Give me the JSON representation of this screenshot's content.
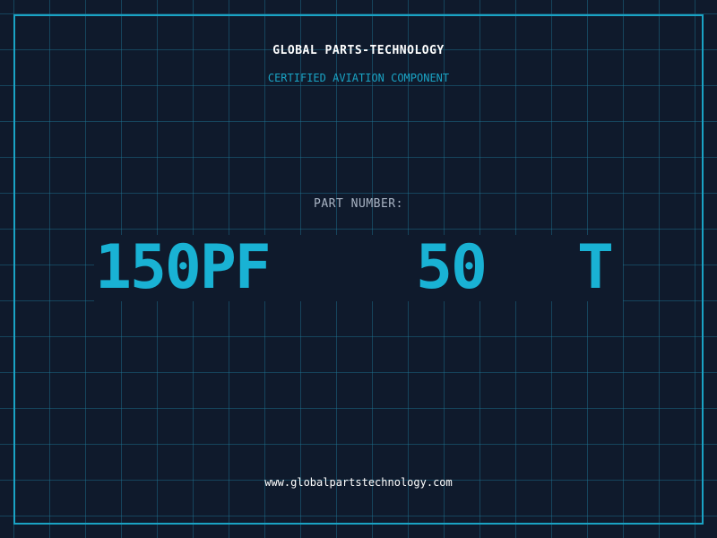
{
  "header": {
    "title": "GLOBAL PARTS-TECHNOLOGY",
    "subtitle": "CERTIFIED AVIATION COMPONENT"
  },
  "part": {
    "label": "PART NUMBER:",
    "segments": [
      "150PF",
      "50",
      "T"
    ]
  },
  "footer": {
    "url": "www.globalpartstechnology.com"
  },
  "colors": {
    "background": "#0f1a2c",
    "grid": "#1e7896",
    "accent": "#1aa3c4",
    "part_number": "#19b2d4",
    "label": "#a9b4c4",
    "text": "#ffffff"
  }
}
